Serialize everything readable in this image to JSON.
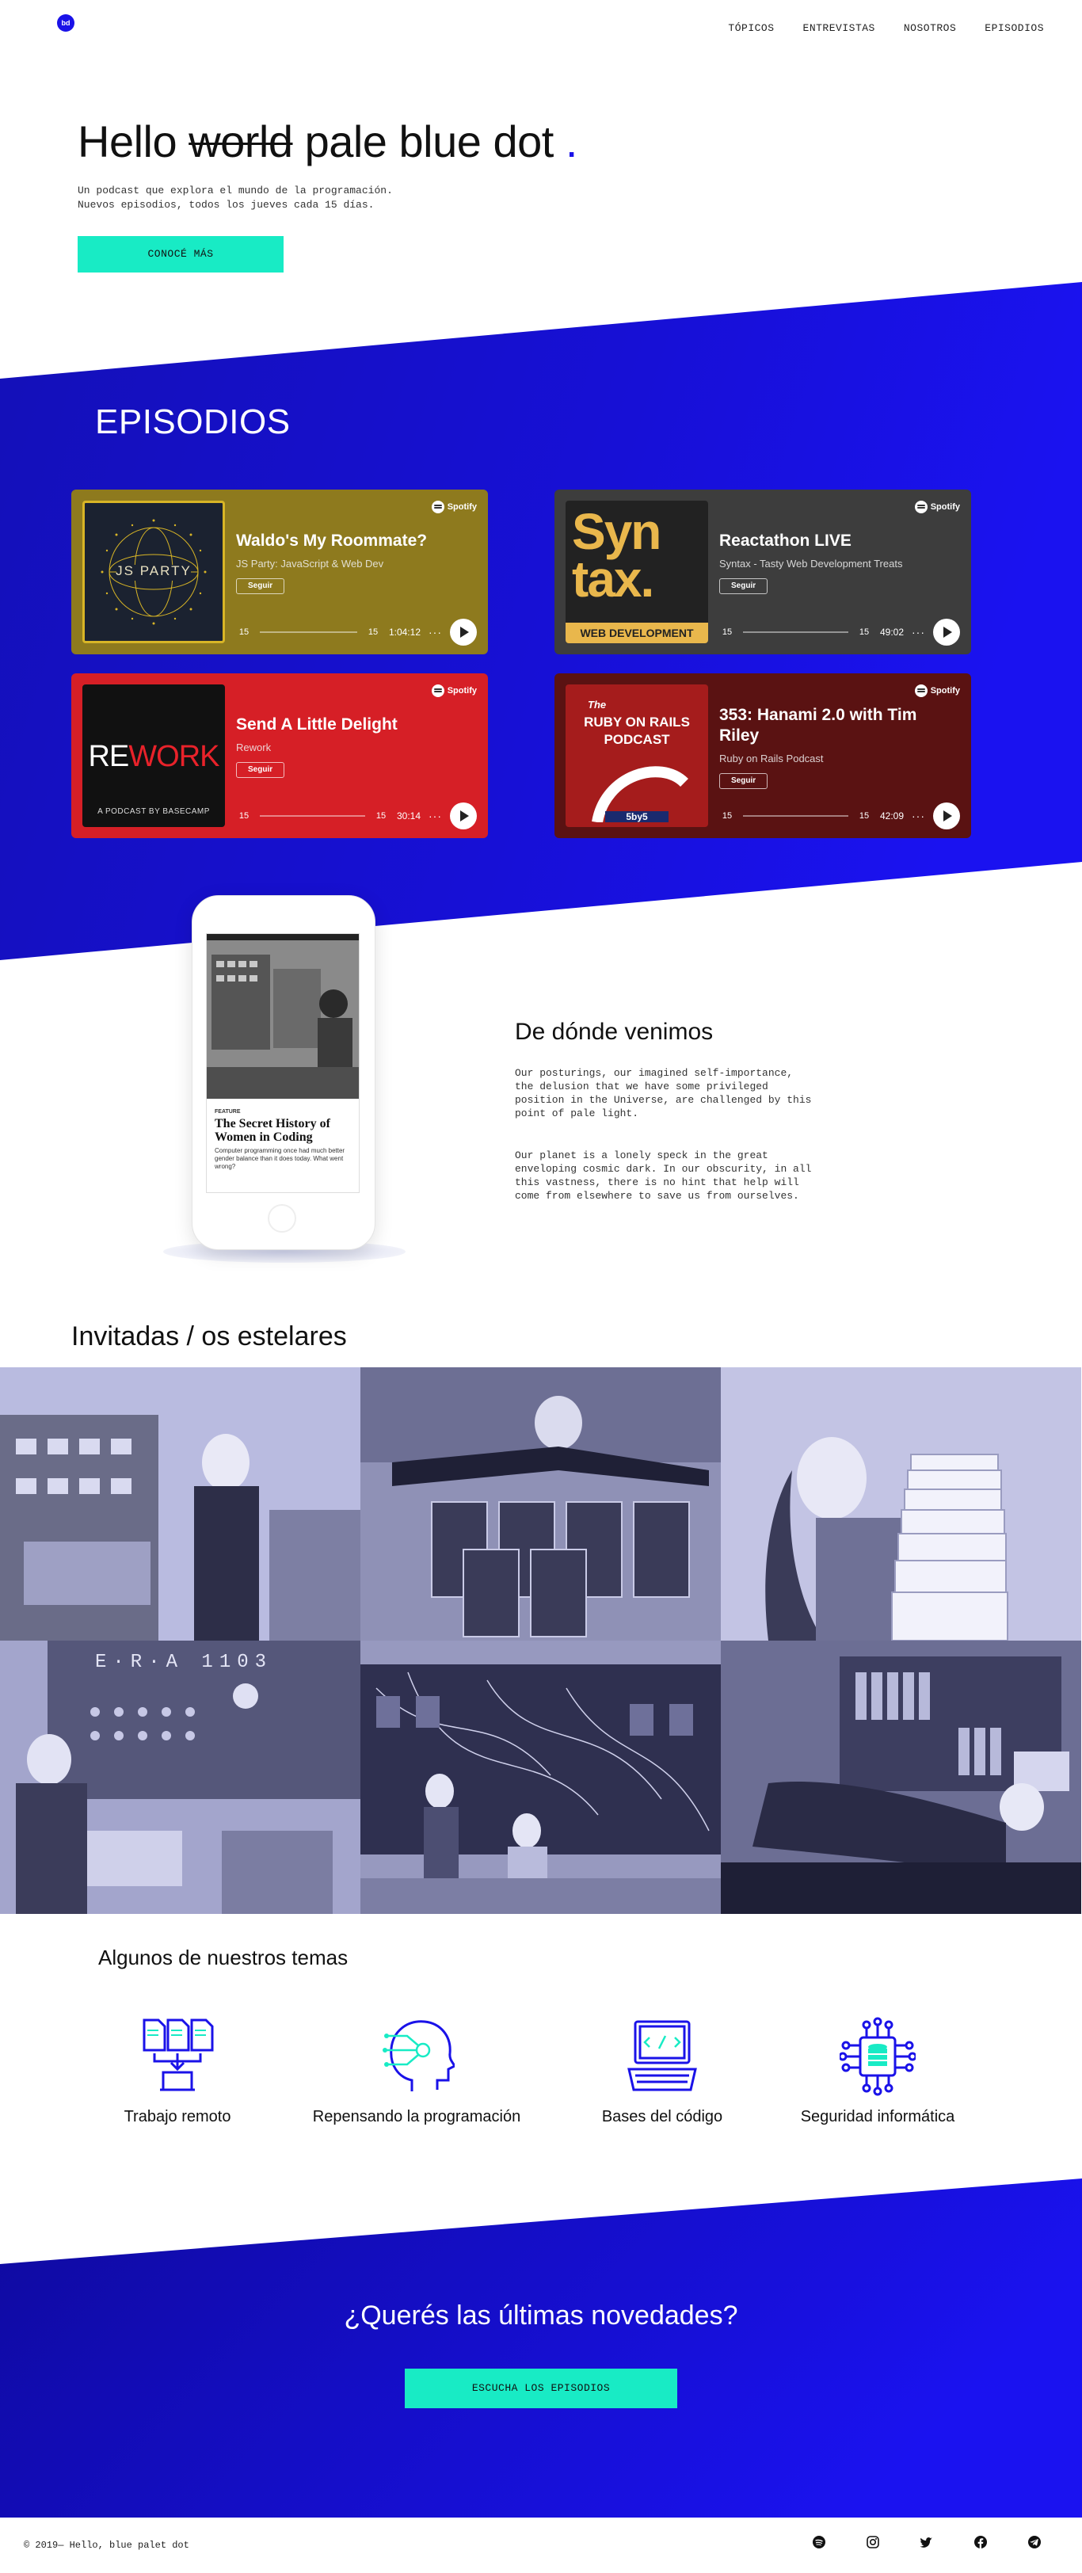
{
  "header": {
    "logo_text": "bd",
    "nav": [
      "TÓPICOS",
      "ENTREVISTAS",
      "NOSOTROS",
      "EPISODIOS"
    ]
  },
  "hero": {
    "title_a": "Hello",
    "title_struck": "world",
    "title_b": "pale blue dot",
    "title_dot": ".",
    "subtitle": "Un podcast que explora el mundo de la programación.\nNuevos episodios, todos los jueves cada 15 días.",
    "cta": "CONOCÉ MÁS"
  },
  "episodes": {
    "title": "EPISODIOS",
    "spotify_label": "Spotify",
    "follow_label": "Seguir",
    "skip_back": "15",
    "skip_fwd": "15",
    "more": "···",
    "items": [
      {
        "title": "Waldo's My Roommate?",
        "show": "JS Party: JavaScript & Web Dev",
        "duration": "1:04:12",
        "color": "#8e7a1e",
        "cover_text": "JS PARTY"
      },
      {
        "title": "Reactathon LIVE",
        "show": "Syntax - Tasty Web Development Treats",
        "duration": "49:02",
        "color": "#3d3d3d",
        "cover_text_a": "Syn",
        "cover_text_b": "tax.",
        "cover_text_c": "WEB DEVELOPMENT"
      },
      {
        "title": "Send A Little Delight",
        "show": "Rework",
        "duration": "30:14",
        "color": "#d61f26",
        "cover_text_a": "RE",
        "cover_text_b": "WORK",
        "cover_text_c": "A PODCAST BY BASECAMP"
      },
      {
        "title": "353: Hanami 2.0 with Tim Riley",
        "show": "Ruby on Rails Podcast",
        "duration": "42:09",
        "color": "#5a1212",
        "cover_text_a": "The",
        "cover_text_b": "RUBY ON RAILS",
        "cover_text_c": "PODCAST",
        "cover_text_d": "5by5"
      }
    ]
  },
  "about": {
    "title": "De dónde venimos",
    "p1": "Our posturings, our imagined self-importance, the delusion that we have some privileged position in the Universe, are challenged by this point of pale light.",
    "p2": "Our planet is a lonely speck in the great enveloping cosmic dark. In our obscurity, in all this vastness, there is no hint that help will come from elsewhere to save us from ourselves.",
    "phone": {
      "caption": "FEATURE",
      "headline": "The Secret History of Women in Coding",
      "deck": "Computer programming once had much better gender balance than it does today. What went wrong?"
    }
  },
  "guests": {
    "title": "Invitadas / os estelares",
    "era_text": "E·R·A   1103"
  },
  "topics": {
    "title": "Algunos de nuestros temas",
    "items": [
      {
        "label": "Trabajo remoto",
        "icon": "remote-work-icon"
      },
      {
        "label": "Repensando la programación",
        "icon": "head-circuit-icon"
      },
      {
        "label": "Bases del código",
        "icon": "laptop-code-icon"
      },
      {
        "label": "Seguridad informática",
        "icon": "database-network-icon"
      }
    ]
  },
  "cta": {
    "title": "¿Querés las últimas novedades?",
    "button": "ESCUCHA LOS EPISODIOS"
  },
  "footer": {
    "copy": "© 2019— Hello, blue palet dot",
    "social": [
      "spotify-icon",
      "instagram-icon",
      "twitter-icon",
      "facebook-icon",
      "telegram-icon"
    ]
  },
  "colors": {
    "brand": "#1a12e8",
    "accent": "#18ebc5",
    "band_dark": "#0f0a9e"
  }
}
